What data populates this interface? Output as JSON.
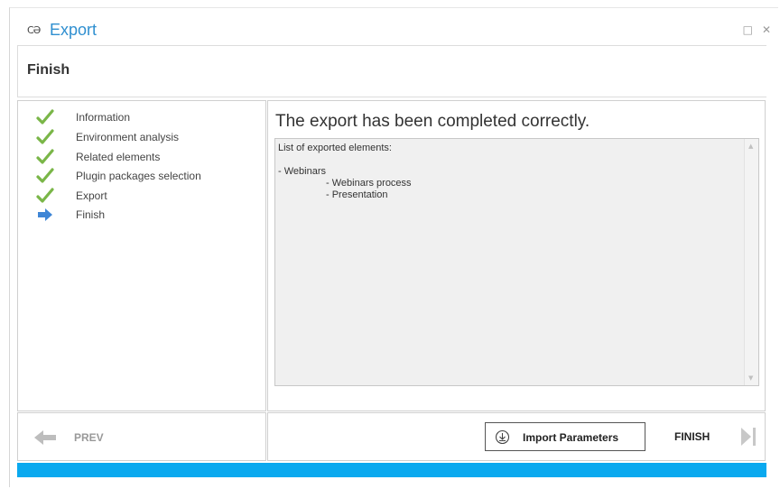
{
  "window": {
    "logo_text": "CƏ",
    "title": "Export",
    "maximize_glyph": "□",
    "close_glyph": "✕"
  },
  "step": {
    "title": "Finish"
  },
  "nav": {
    "items": [
      {
        "label": "Information",
        "status": "done",
        "icon": "check-icon"
      },
      {
        "label": "Environment analysis",
        "status": "done",
        "icon": "check-icon"
      },
      {
        "label": "Related elements",
        "status": "done",
        "icon": "check-icon"
      },
      {
        "label": "Plugin packages selection",
        "status": "done",
        "icon": "check-icon"
      },
      {
        "label": "Export",
        "status": "done",
        "icon": "check-icon"
      },
      {
        "label": "Finish",
        "status": "current",
        "icon": "arrow-right-icon"
      }
    ]
  },
  "main": {
    "heading": "The export has been completed correctly.",
    "list_header": "List of exported elements:",
    "list_lines": [
      {
        "text": "- Webinars",
        "level": 0
      },
      {
        "text": "- Webinars process",
        "level": 1
      },
      {
        "text": "- Presentation",
        "level": 1
      }
    ]
  },
  "footer": {
    "prev_label": "PREV",
    "import_label": "Import Parameters",
    "finish_label": "FINISH"
  },
  "progress": {
    "value": 1.0
  },
  "colors": {
    "accent": "#2f8fd0",
    "progress": "#0aa9ef",
    "check": "#7ab648",
    "arrow": "#3f86d6",
    "disabled": "#bdbdbd"
  }
}
